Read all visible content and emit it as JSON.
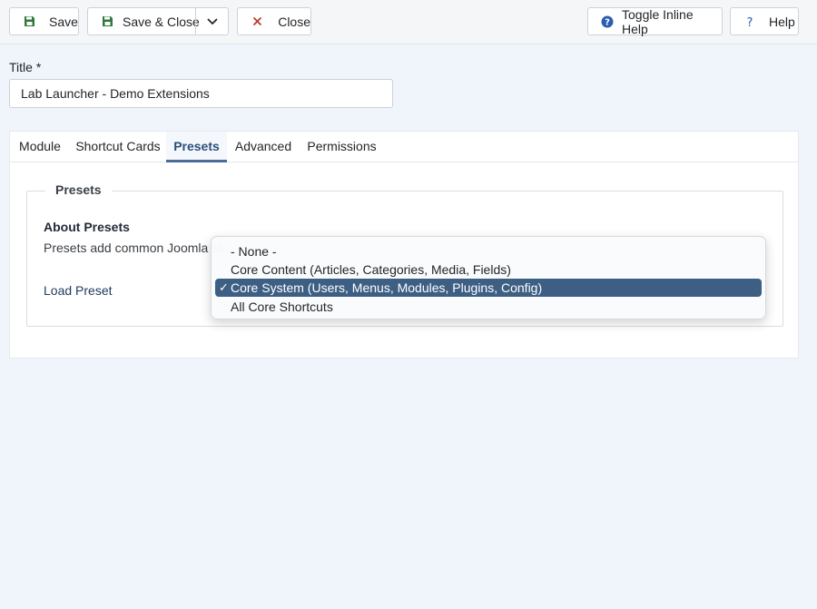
{
  "toolbar": {
    "save_label": "Save",
    "save_close_label": "Save & Close",
    "close_label": "Close",
    "toggle_help_label": "Toggle Inline Help",
    "help_label": "Help"
  },
  "title_field": {
    "label": "Title *",
    "value": "Lab Launcher - Demo Extensions"
  },
  "tabs": [
    {
      "label": "Module"
    },
    {
      "label": "Shortcut Cards"
    },
    {
      "label": "Presets",
      "active": true
    },
    {
      "label": "Advanced"
    },
    {
      "label": "Permissions"
    }
  ],
  "presets": {
    "legend": "Presets",
    "about_heading": "About Presets",
    "about_text": "Presets add common Joomla sho",
    "load_label": "Load Preset",
    "options": [
      {
        "label": "- None -"
      },
      {
        "label": "Core Content (Articles, Categories, Media, Fields)"
      },
      {
        "label": "Core System (Users, Menus, Modules, Plugins, Config)",
        "selected": true
      },
      {
        "label": "All Core Shortcuts"
      }
    ],
    "check_mark": "✓"
  },
  "colors": {
    "save_icon": "#2f7a3b",
    "close_icon": "#c0392b",
    "help_icon": "#2a5db0",
    "selected_option": "#3e5f84",
    "active_tab": "#2a4f7c"
  },
  "icons": {
    "save": "floppy-disk-icon",
    "caret": "chevron-down-icon",
    "close": "close-icon",
    "toggle_help": "question-circle-icon",
    "help": "question-mark-icon"
  }
}
